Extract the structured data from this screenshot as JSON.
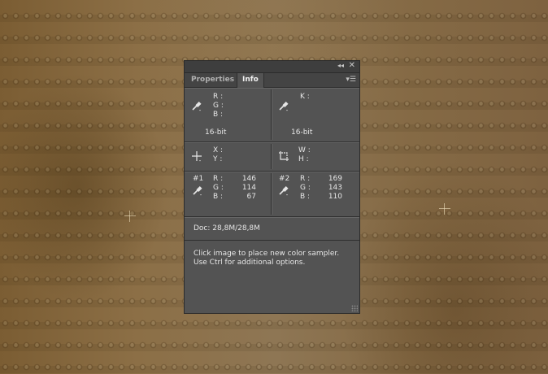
{
  "panel": {
    "tabs": [
      {
        "label": "Properties",
        "active": false
      },
      {
        "label": "Info",
        "active": true
      }
    ],
    "rgb": {
      "r": "R :",
      "g": "G :",
      "b": "B :",
      "bit": "16-bit"
    },
    "cmyk": {
      "k": "K :",
      "bit": "16-bit"
    },
    "position": {
      "x": "X :",
      "y": "Y :"
    },
    "size": {
      "w": "W :",
      "h": "H :"
    },
    "samplers": [
      {
        "label": "#1",
        "r_label": "R :",
        "g_label": "G :",
        "b_label": "B :",
        "r": "146",
        "g": "114",
        "b": "67"
      },
      {
        "label": "#2",
        "r_label": "R :",
        "g_label": "G :",
        "b_label": "B :",
        "r": "169",
        "g": "143",
        "b": "110"
      }
    ],
    "doc": "Doc: 28,8M/28,8M",
    "help_line1": "Click image to place new color sampler.",
    "help_line2": "Use Ctrl for additional options."
  },
  "icons": {
    "collapse": "double-chevron-left-icon",
    "close": "close-icon",
    "menu": "panel-menu-icon",
    "eyedropper": "eyedropper-icon",
    "crosshair": "crosshair-icon",
    "size": "selection-size-icon"
  }
}
